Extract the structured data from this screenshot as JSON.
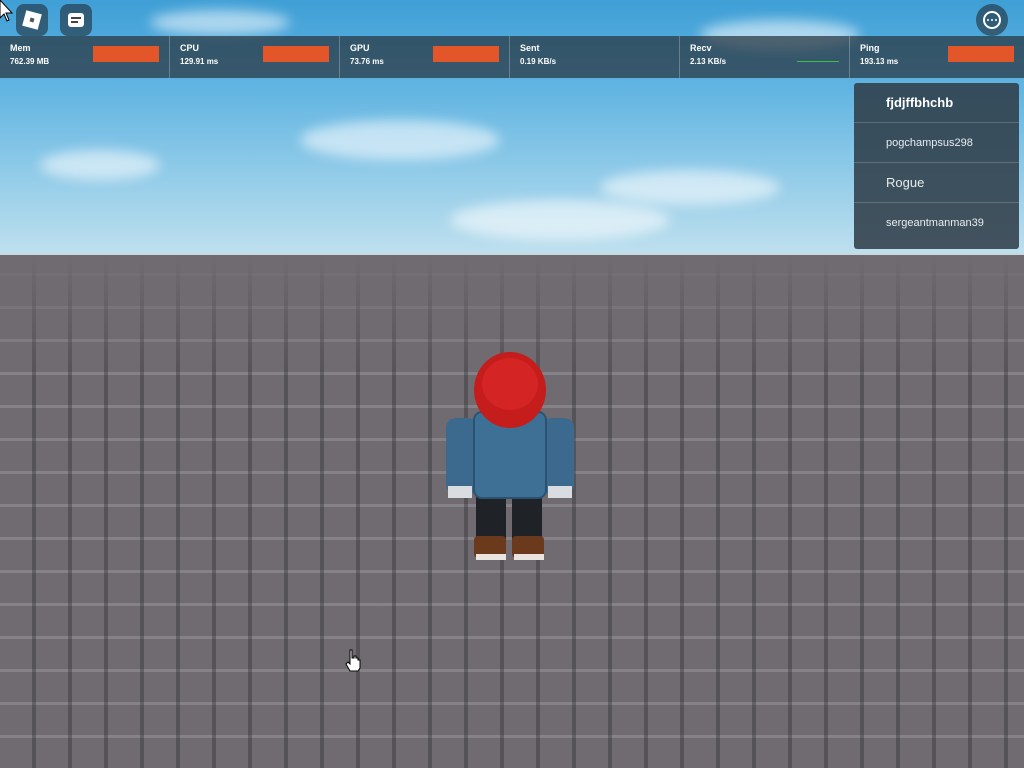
{
  "top_bar": {
    "roblox_menu_icon": "roblox-logo-icon",
    "chat_icon": "chat-icon",
    "more_icon": "more-options-icon"
  },
  "stats": [
    {
      "label": "Mem",
      "value": "762.39 MB",
      "graph_color": "#e2562a"
    },
    {
      "label": "CPU",
      "value": "129.91 ms",
      "graph_color": "#e2562a"
    },
    {
      "label": "GPU",
      "value": "73.76 ms",
      "graph_color": "#e2562a"
    },
    {
      "label": "Sent",
      "value": "0.19 KB/s",
      "graph_color": "#3fbf3f"
    },
    {
      "label": "Recv",
      "value": "2.13 KB/s",
      "graph_color": "#3fbf3f"
    },
    {
      "label": "Ping",
      "value": "193.13 ms",
      "graph_color": "#e2562a"
    }
  ],
  "players": [
    {
      "name": "fjdjffbhchb"
    },
    {
      "name": "pogchampsus298"
    },
    {
      "name": "Rogue"
    },
    {
      "name": "sergeantmanman39"
    }
  ],
  "colors": {
    "stat_bad": "#e2562a",
    "stat_good": "#3fbf3f",
    "sky": "#62b5e2",
    "baseplate": "#6f6b70"
  }
}
